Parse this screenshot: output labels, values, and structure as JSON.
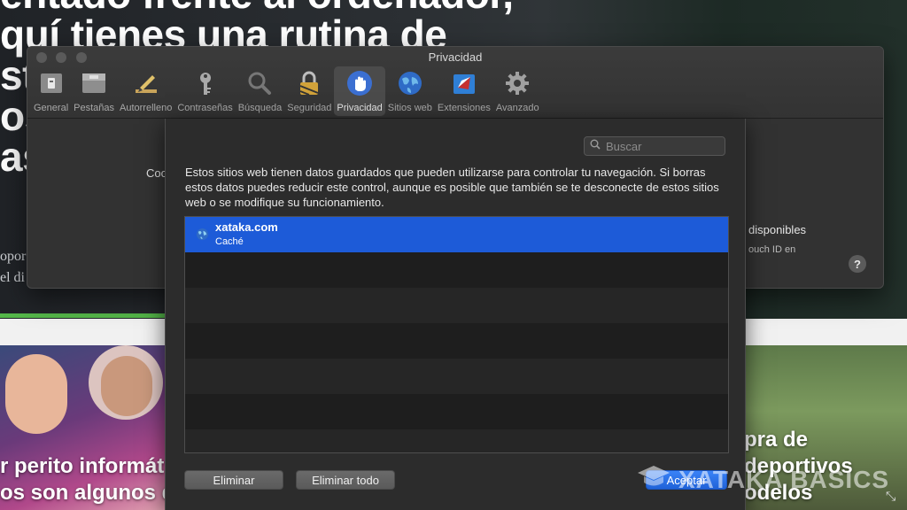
{
  "background": {
    "headline_lines": [
      "entado frente al ordenador,",
      "quí tienes una rutina de",
      "st",
      "os",
      "as"
    ],
    "body_lines": [
      "opor",
      "el di"
    ],
    "caption_left": [
      "r perito informát",
      "os son algunos d"
    ],
    "caption_right": [
      "pra de",
      "deportivos",
      "odelos"
    ]
  },
  "window": {
    "title": "Privacidad",
    "toolbar": [
      {
        "label": "General",
        "icon": "general-icon"
      },
      {
        "label": "Pestañas",
        "icon": "tabs-icon"
      },
      {
        "label": "Autorrelleno",
        "icon": "pencil-icon"
      },
      {
        "label": "Contraseñas",
        "icon": "key-icon"
      },
      {
        "label": "Búsqueda",
        "icon": "magnifier-icon"
      },
      {
        "label": "Seguridad",
        "icon": "lock-icon"
      },
      {
        "label": "Privacidad",
        "icon": "hand-icon"
      },
      {
        "label": "Sitios web",
        "icon": "globe-icon"
      },
      {
        "label": "Extensiones",
        "icon": "puzzle-icon"
      },
      {
        "label": "Avanzado",
        "icon": "gear-icon"
      }
    ],
    "active_tab": "Privacidad",
    "body_left_text": "Coo",
    "body_right_text_1": "disponibles",
    "body_right_text_2": "ouch ID en",
    "help_label": "?"
  },
  "sheet": {
    "search_placeholder": "Buscar",
    "description": "Estos sitios web tienen datos guardados que pueden utilizarse para controlar tu navegación. Si borras estos datos puedes reducir este control, aunque es posible que también se te desconecte de estos sitios web o se modifique su funcionamiento.",
    "sites": [
      {
        "name": "xataka.com",
        "data_type": "Caché",
        "selected": true
      }
    ],
    "buttons": {
      "remove": "Eliminar",
      "remove_all": "Eliminar todo",
      "accept": "Aceptar"
    }
  },
  "watermark": "XATAKA BASICS",
  "colors": {
    "selection": "#1d5bd8",
    "accent_button": "#2a6fe6",
    "green_bar": "#55b84a"
  }
}
